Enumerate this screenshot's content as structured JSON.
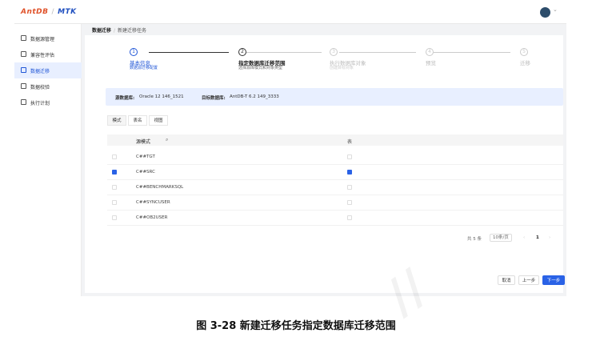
{
  "header": {
    "logo_left": "AntDB",
    "logo_right": "MTK"
  },
  "sidebar": {
    "items": [
      {
        "label": "数据源管理",
        "icon": "database-icon",
        "active": false
      },
      {
        "label": "兼容性评估",
        "icon": "document-icon",
        "active": false
      },
      {
        "label": "数据迁移",
        "icon": "folder-icon",
        "active": true
      },
      {
        "label": "数据校验",
        "icon": "check-icon",
        "active": false
      },
      {
        "label": "执行计划",
        "icon": "calendar-icon",
        "active": false
      }
    ]
  },
  "breadcrumb": {
    "parent": "数据迁移",
    "current": "新建迁移任务"
  },
  "steps": [
    {
      "num": "1",
      "title": "基本信息",
      "desc": "数据源迁移配置",
      "state": "done"
    },
    {
      "num": "2",
      "title": "指定数据库迁移范围",
      "desc": "选择源库模式和对象类型",
      "state": "current"
    },
    {
      "num": "3",
      "title": "执行数据库对象",
      "desc": "创建目标对象",
      "state": "wait"
    },
    {
      "num": "4",
      "title": "预览",
      "desc": "",
      "state": "wait"
    },
    {
      "num": "5",
      "title": "迁移",
      "desc": "",
      "state": "wait"
    }
  ],
  "db_info": {
    "source_label": "源数据库:",
    "source_value": "Oracle 12 146_1521",
    "target_label": "目标数据库:",
    "target_value": "AntDB-T 6.2 149_3333"
  },
  "tabs": [
    {
      "label": "模式",
      "active": true
    },
    {
      "label": "表名",
      "active": false
    },
    {
      "label": "视图",
      "active": false
    }
  ],
  "table": {
    "col1": "源模式",
    "col2": "表",
    "rows": [
      {
        "name": "C##TGT",
        "checked": false,
        "table_checked": false
      },
      {
        "name": "C##SRC",
        "checked": true,
        "table_checked": true
      },
      {
        "name": "C##BENCHMARKSQL",
        "checked": false,
        "table_checked": false
      },
      {
        "name": "C##SYNCUSER",
        "checked": false,
        "table_checked": false
      },
      {
        "name": "C##OB2USER",
        "checked": false,
        "table_checked": false
      }
    ]
  },
  "pagination": {
    "total": "共 5 条",
    "page_size": "10条/页",
    "prev": "‹",
    "page": "1",
    "next": "›"
  },
  "actions": {
    "cancel": "取消",
    "prev": "上一步",
    "next": "下一步"
  },
  "caption": "图 3-28  新建迁移任务指定数据库迁移范围",
  "colors": {
    "accent": "#2a62e6",
    "brand": "#e0522a"
  }
}
